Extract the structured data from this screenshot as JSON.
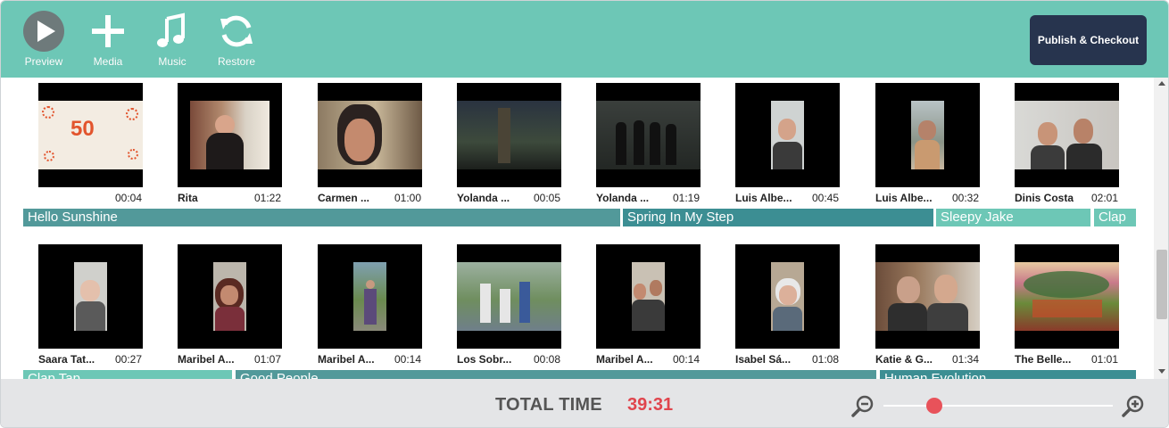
{
  "toolbar": {
    "preview_label": "Preview",
    "media_label": "Media",
    "music_label": "Music",
    "restore_label": "Restore",
    "publish_label": "Publish & Checkout"
  },
  "clips_row1": [
    {
      "name": "",
      "duration": "00:04",
      "thumb_text": "50"
    },
    {
      "name": "Rita",
      "duration": "01:22"
    },
    {
      "name": "Carmen ...",
      "duration": "01:00"
    },
    {
      "name": "Yolanda ...",
      "duration": "00:05"
    },
    {
      "name": "Yolanda ...",
      "duration": "01:19"
    },
    {
      "name": "Luis Albe...",
      "duration": "00:45"
    },
    {
      "name": "Luis Albe...",
      "duration": "00:32"
    },
    {
      "name": "Dinis Costa",
      "duration": "02:01"
    }
  ],
  "tracks_row1": [
    {
      "title": "Hello Sunshine"
    },
    {
      "title": "Spring In My Step"
    },
    {
      "title": "Sleepy Jake"
    },
    {
      "title": "Clap"
    }
  ],
  "clips_row2": [
    {
      "name": "Saara Tat...",
      "duration": "00:27"
    },
    {
      "name": "Maribel A...",
      "duration": "01:07"
    },
    {
      "name": "Maribel A...",
      "duration": "00:14"
    },
    {
      "name": "Los Sobr...",
      "duration": "00:08"
    },
    {
      "name": "Maribel A...",
      "duration": "00:14"
    },
    {
      "name": "Isabel Sá...",
      "duration": "01:08"
    },
    {
      "name": "Katie & G...",
      "duration": "01:34"
    },
    {
      "name": "The Belle...",
      "duration": "01:01"
    }
  ],
  "tracks_row2": [
    {
      "title": "Clap Tap"
    },
    {
      "title": "Good People"
    },
    {
      "title": "Human Evolution"
    }
  ],
  "footer": {
    "total_label": "TOTAL TIME",
    "total_value": "39:31",
    "zoom_level": 0.22
  },
  "colors": {
    "toolbar_bg": "#6dc7b6",
    "publish_bg": "#27344e",
    "track_dark": "#3c8e93",
    "track_mid": "#52999a",
    "track_light": "#6dc7b6",
    "accent_red": "#e0454d"
  }
}
